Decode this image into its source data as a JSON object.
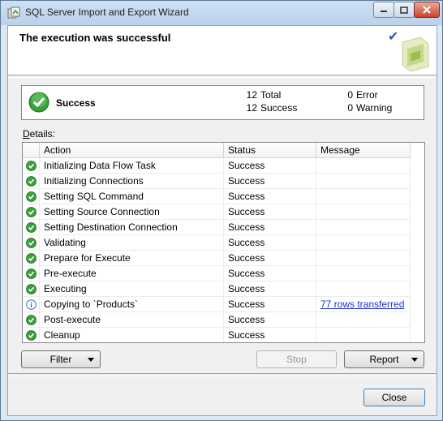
{
  "window": {
    "title": "SQL Server Import and Export Wizard"
  },
  "header": {
    "title": "The execution was successful"
  },
  "summary": {
    "status": "Success",
    "total_count": "12",
    "total_label": "Total",
    "success_count": "12",
    "success_label": "Success",
    "error_count": "0",
    "error_label": "Error",
    "warning_count": "0",
    "warning_label": "Warning"
  },
  "details": {
    "label_accel": "D",
    "label_rest": "etails:",
    "columns": [
      "Action",
      "Status",
      "Message"
    ],
    "rows": [
      {
        "icon": "success-icon",
        "action": "Initializing Data Flow Task",
        "status": "Success",
        "message": ""
      },
      {
        "icon": "success-icon",
        "action": "Initializing Connections",
        "status": "Success",
        "message": ""
      },
      {
        "icon": "success-icon",
        "action": "Setting SQL Command",
        "status": "Success",
        "message": ""
      },
      {
        "icon": "success-icon",
        "action": "Setting Source Connection",
        "status": "Success",
        "message": ""
      },
      {
        "icon": "success-icon",
        "action": "Setting Destination Connection",
        "status": "Success",
        "message": ""
      },
      {
        "icon": "success-icon",
        "action": "Validating",
        "status": "Success",
        "message": ""
      },
      {
        "icon": "success-icon",
        "action": "Prepare for Execute",
        "status": "Success",
        "message": ""
      },
      {
        "icon": "success-icon",
        "action": "Pre-execute",
        "status": "Success",
        "message": ""
      },
      {
        "icon": "success-icon",
        "action": "Executing",
        "status": "Success",
        "message": ""
      },
      {
        "icon": "info-icon",
        "action": "Copying to `Products`",
        "status": "Success",
        "message": "77 rows transferred"
      },
      {
        "icon": "success-icon",
        "action": "Post-execute",
        "status": "Success",
        "message": ""
      },
      {
        "icon": "success-icon",
        "action": "Cleanup",
        "status": "Success",
        "message": ""
      }
    ]
  },
  "buttons": {
    "filter": "Filter",
    "stop": "Stop",
    "report": "Report",
    "close": "Close"
  },
  "colors": {
    "success_green": "#3aa03a",
    "link_blue": "#1a32c8",
    "info_blue": "#3b6fb6"
  }
}
